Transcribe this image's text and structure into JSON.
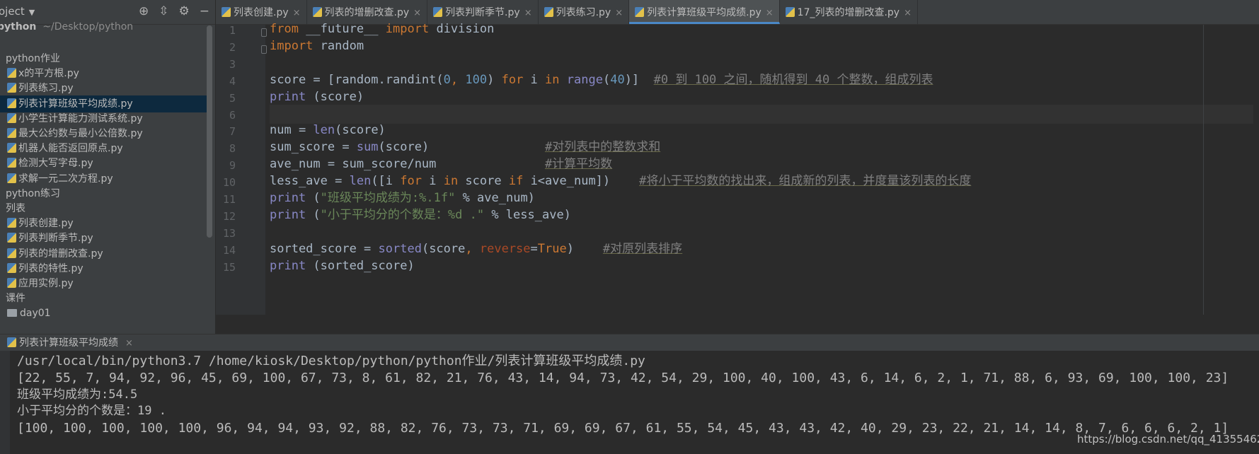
{
  "sidebar": {
    "title": "oject",
    "root": {
      "name": "python",
      "path": "~/Desktop/python"
    },
    "items": [
      {
        "label": "python作业",
        "kind": "folder"
      },
      {
        "label": "x的平方根.py",
        "kind": "file"
      },
      {
        "label": "列表练习.py",
        "kind": "file"
      },
      {
        "label": "列表计算班级平均成绩.py",
        "kind": "file",
        "selected": true
      },
      {
        "label": "小学生计算能力测试系统.py",
        "kind": "file"
      },
      {
        "label": "最大公约数与最小公倍数.py",
        "kind": "file"
      },
      {
        "label": "机器人能否返回原点.py",
        "kind": "file"
      },
      {
        "label": "检测大写字母.py",
        "kind": "file"
      },
      {
        "label": "求解一元二次方程.py",
        "kind": "file"
      },
      {
        "label": "python练习",
        "kind": "folder"
      },
      {
        "label": "列表",
        "kind": "folder"
      },
      {
        "label": "列表创建.py",
        "kind": "file"
      },
      {
        "label": "列表判断季节.py",
        "kind": "file"
      },
      {
        "label": "列表的增删改查.py",
        "kind": "file"
      },
      {
        "label": "列表的特性.py",
        "kind": "file"
      },
      {
        "label": "应用实例.py",
        "kind": "file"
      },
      {
        "label": "课件",
        "kind": "folder"
      },
      {
        "label": "day01",
        "kind": "dir"
      }
    ]
  },
  "tabs": [
    {
      "label": "列表创建.py",
      "active": false
    },
    {
      "label": "列表的增删改查.py",
      "active": false
    },
    {
      "label": "列表判断季节.py",
      "active": false
    },
    {
      "label": "列表练习.py",
      "active": false
    },
    {
      "label": "列表计算班级平均成绩.py",
      "active": true
    },
    {
      "label": "17_列表的增删改查.py",
      "active": false
    }
  ],
  "tab_close_glyph": "×",
  "editor": {
    "line_numbers": [
      "1",
      "2",
      "3",
      "4",
      "5",
      "6",
      "7",
      "8",
      "9",
      "10",
      "11",
      "12",
      "13",
      "14",
      "15"
    ],
    "lines": [
      "from __future__ import division",
      "import random",
      "",
      "score = [random.randint(0, 100) for i in range(40)]  #0 到 100 之间，随机得到 40 个整数，组成列表",
      "print (score)",
      "",
      "num = len(score)",
      "sum_score = sum(score)                #对列表中的整数求和",
      "ave_num = sum_score/num               #计算平均数",
      "less_ave = len([i for i in score if i<ave_num])    #将小于平均数的找出来，组成新的列表，并度量该列表的长度",
      "print (\"班级平均成绩为:%.1f\" % ave_num)",
      "print (\"小于平均分的个数是：%d .\" % less_ave)",
      "",
      "sorted_score = sorted(score, reverse=True)    #对原列表排序",
      "print (sorted_score)"
    ]
  },
  "run": {
    "tab_label": "列表计算班级平均成绩",
    "output": [
      "/usr/local/bin/python3.7 /home/kiosk/Desktop/python/python作业/列表计算班级平均成绩.py",
      "[22, 55, 7, 94, 92, 96, 45, 69, 100, 67, 73, 8, 61, 82, 21, 76, 43, 14, 94, 73, 42, 54, 29, 100, 40, 100, 43, 6, 14, 6, 2, 1, 71, 88, 6, 93, 69, 100, 100, 23]",
      "班级平均成绩为:54.5",
      "小于平均分的个数是：19 .",
      "[100, 100, 100, 100, 100, 96, 94, 94, 93, 92, 88, 82, 76, 73, 73, 71, 69, 69, 67, 61, 55, 54, 45, 43, 43, 42, 40, 29, 23, 22, 21, 14, 14, 8, 7, 6, 6, 6, 2, 1]"
    ]
  },
  "watermark": "https://blog.csdn.net/qq_41355462",
  "colors": {
    "keyword": "#cc7832",
    "number": "#6897bb",
    "builtin": "#8888c6",
    "string": "#6a8759",
    "comment": "#808080",
    "selection": "#0d293e",
    "active_tab_underline": "#4a88c7"
  }
}
